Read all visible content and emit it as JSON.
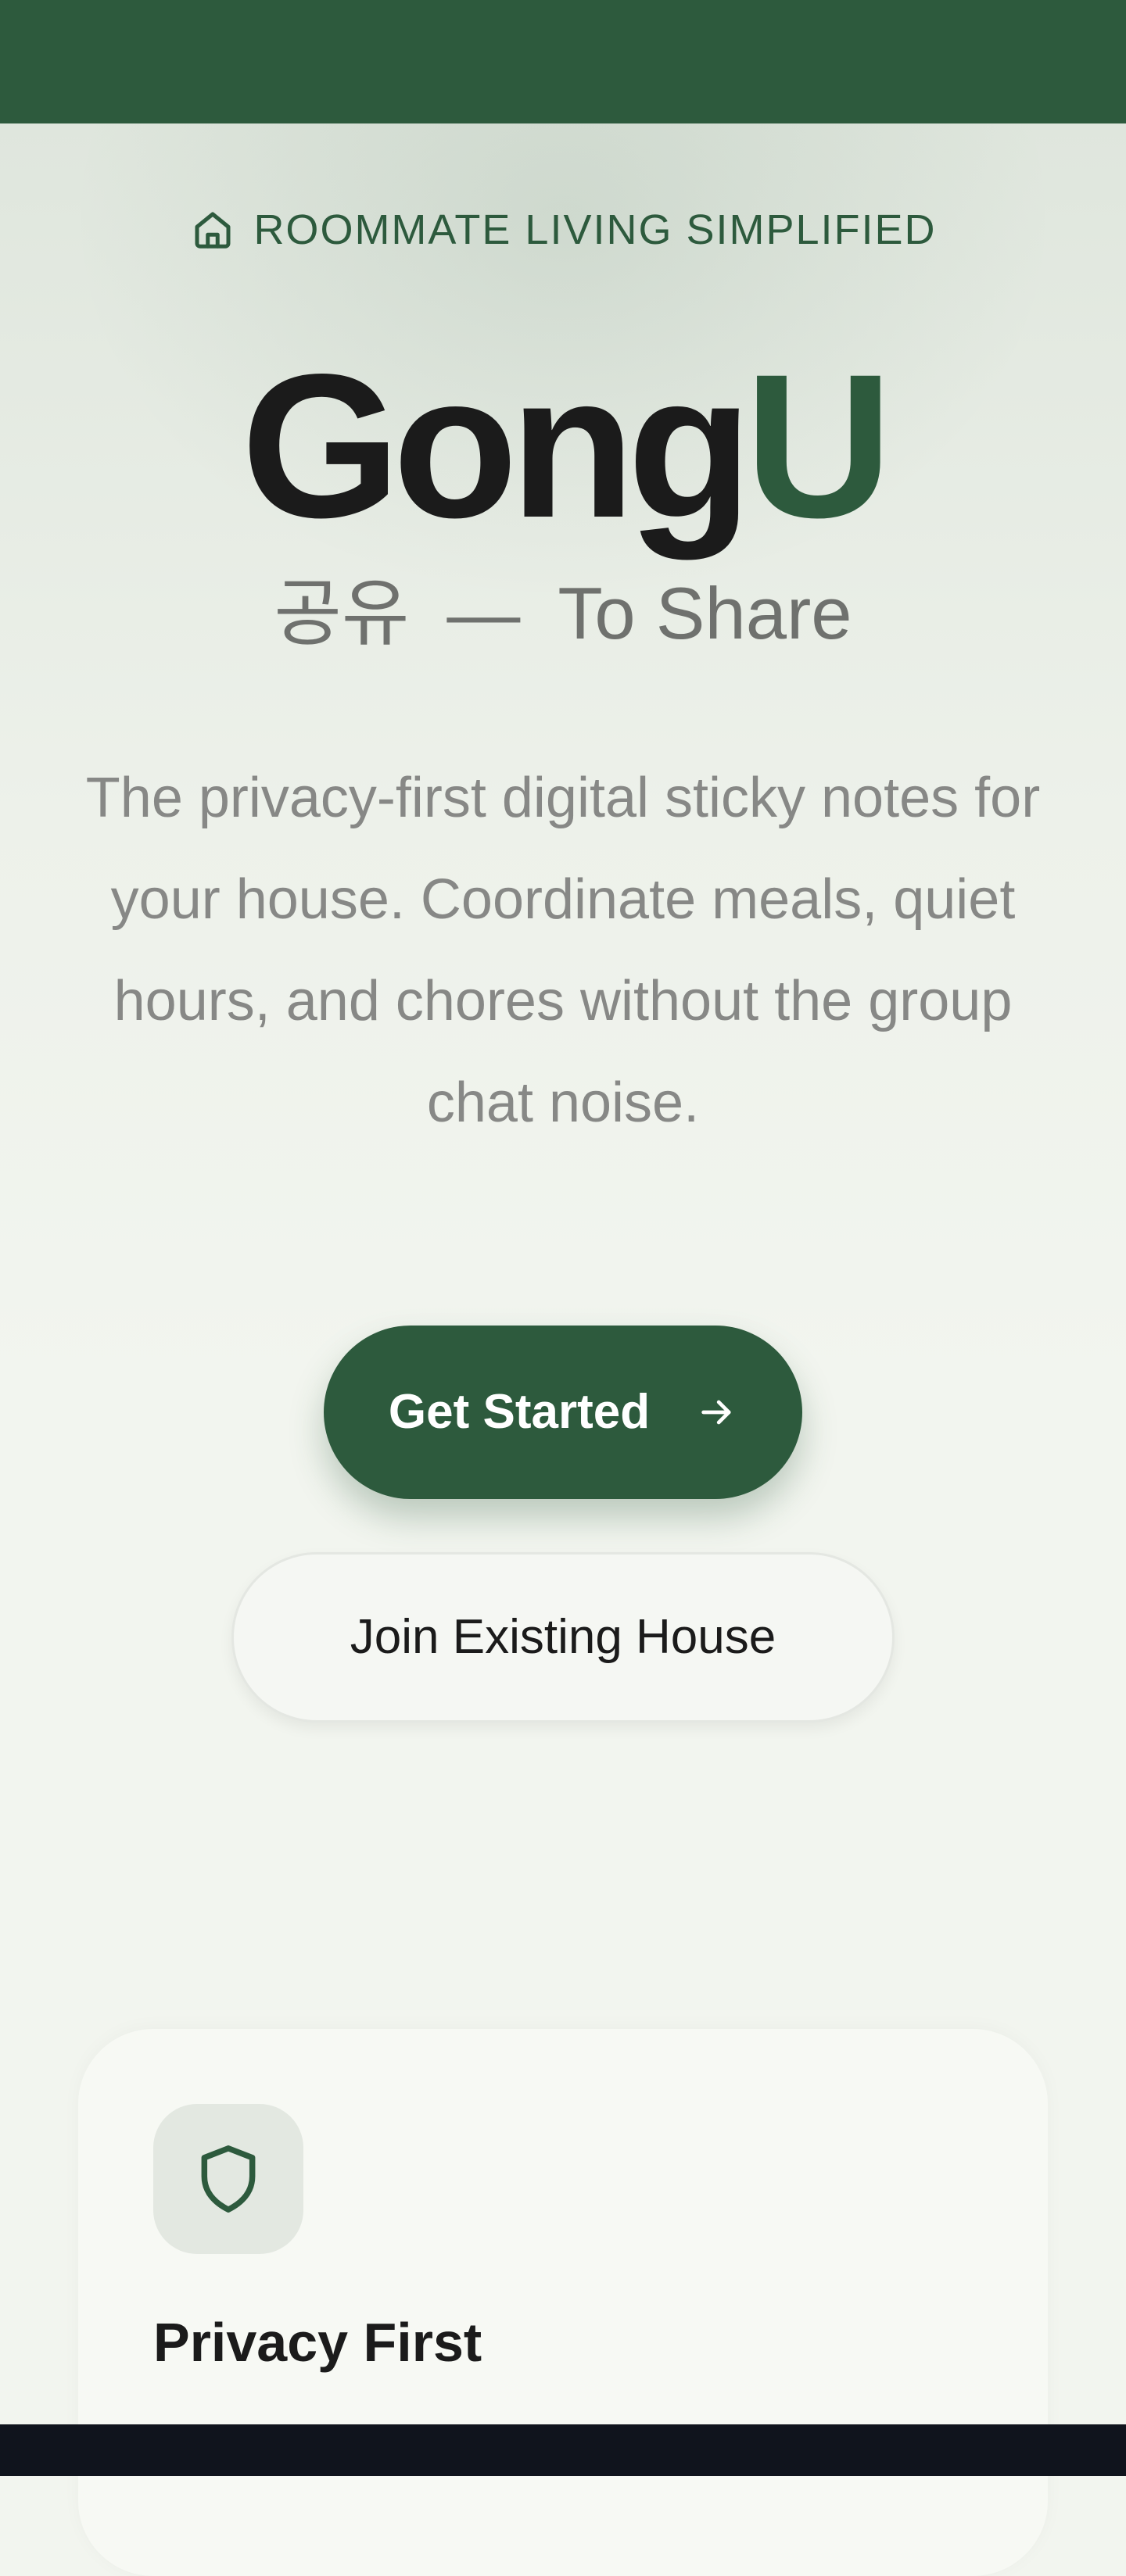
{
  "header": {
    "tagline": "ROOMMATE LIVING SIMPLIFIED",
    "tagline_icon": "home-icon",
    "bar_color": "#2d5a3d"
  },
  "brand": {
    "name_primary": "Gong",
    "name_accent": "U",
    "accent_color": "#2d5a3d"
  },
  "subtitle": {
    "korean": "공유",
    "dash": "—",
    "meaning": "To Share"
  },
  "description": "The privacy-first digital sticky notes for your house. Coordinate meals, quiet hours, and chores without the group chat noise.",
  "actions": {
    "primary_label": "Get Started",
    "primary_icon": "arrow-right-icon",
    "secondary_label": "Join Existing House"
  },
  "features": [
    {
      "icon": "shield-icon",
      "title": "Privacy First"
    }
  ]
}
